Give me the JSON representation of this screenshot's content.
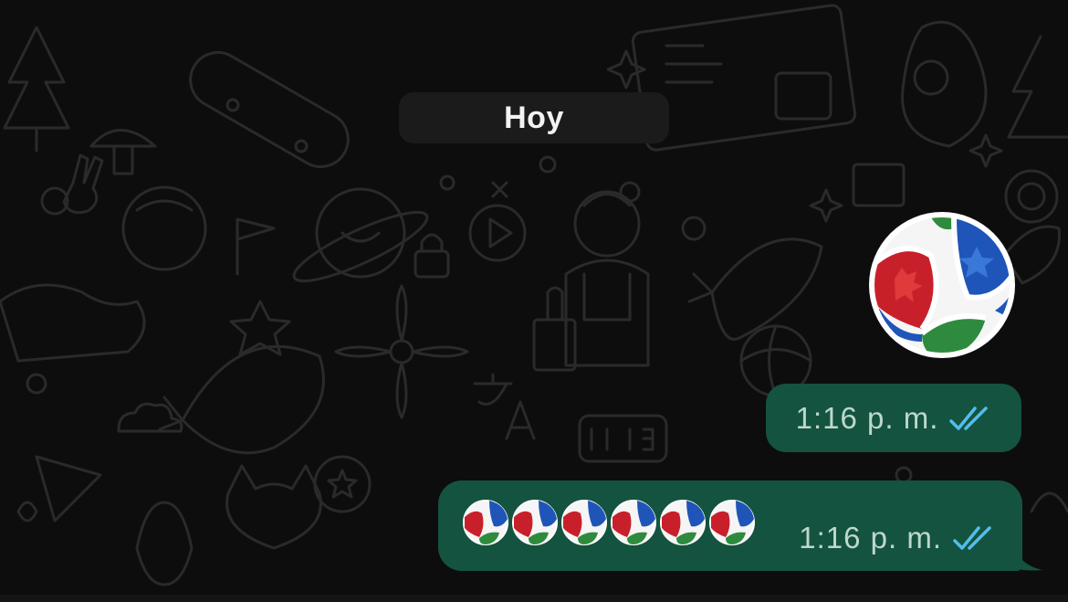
{
  "chat": {
    "date_separator": "Hoy",
    "messages": [
      {
        "type": "sticker",
        "sticker_icon": "soccer-ball-sticker",
        "time": "1:16 p. m.",
        "status": "read",
        "status_icon": "double-check-icon"
      },
      {
        "type": "emoji",
        "emoji_icon": "soccer-ball-emoji",
        "emoji_count": 6,
        "time": "1:16 p. m.",
        "status": "read",
        "status_icon": "double-check-icon"
      }
    ]
  },
  "colors": {
    "background": "#0d0d0d",
    "doodle": "#2a2a2a",
    "date_pill": "#1b1b1b",
    "outgoing_bubble": "#14533f",
    "time_text": "#bcd8cc",
    "read_ticks": "#53bdeb",
    "ball_red": "#c8202a",
    "ball_blue": "#1f55b8",
    "ball_green": "#2e8b3e"
  }
}
